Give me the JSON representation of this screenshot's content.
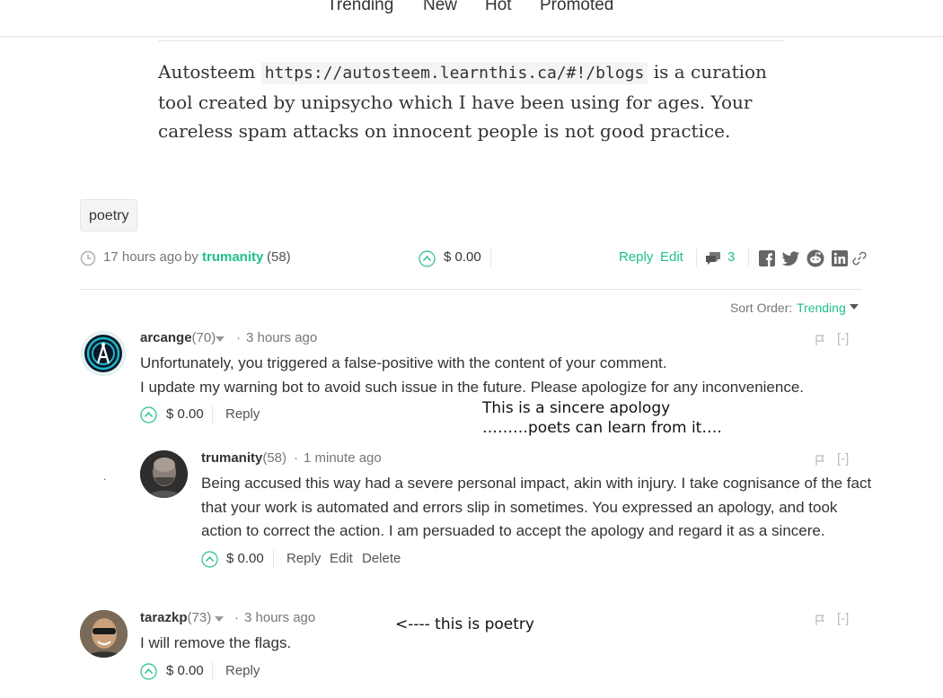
{
  "nav": {
    "items": [
      "Trending",
      "New",
      "Hot",
      "Promoted"
    ]
  },
  "post": {
    "text_before": "Autosteem ",
    "code": "https://autosteem.learnthis.ca/#!/blogs",
    "text_after": " is a curation tool created by unipsycho which I have been using for ages. Your careless spam attacks on innocent people is not good practice.",
    "tag": "poetry",
    "time": "17 hours ago",
    "by": "by",
    "author": "trumanity",
    "author_rep": "(58)",
    "payout": "$ 0.00",
    "reply": "Reply",
    "edit": "Edit",
    "comment_count": "3"
  },
  "sort": {
    "label": "Sort Order:",
    "value": "Trending"
  },
  "comments": [
    {
      "author": "arcange",
      "rep": "(70)",
      "time": "3 hours ago",
      "lines": [
        "Unfortunately, you triggered a false-positive with the content of your comment.",
        "I update my warning bot to avoid such issue in the future. Please apologize for any inconvenience."
      ],
      "payout": "$ 0.00",
      "reply": "Reply",
      "collapse": "[-]"
    },
    {
      "author": "trumanity",
      "rep": "(58)",
      "time": "1 minute ago",
      "lines": [
        "Being accused this way had a severe personal impact, akin with injury. I take cognisance of the fact",
        "that your work is automated and errors slip in sometimes. You expressed an apology, and took",
        "action to correct the action. I am persuaded to accept the apology and regard it as a sincere."
      ],
      "payout": "$ 0.00",
      "reply": "Reply",
      "edit": "Edit",
      "delete": "Delete",
      "collapse": "[-]"
    },
    {
      "author": "tarazkp",
      "rep": "(73)",
      "time": "3 hours ago",
      "lines": [
        "I will remove the flags."
      ],
      "payout": "$ 0.00",
      "reply": "Reply",
      "collapse": "[-]"
    }
  ],
  "annotations": {
    "note1_line1": "This is a sincere apology",
    "note1_line2": "………poets can learn from it….",
    "note2": "<---- this is poetry"
  },
  "colors": {
    "accent": "#1fbf8f",
    "text": "#333333",
    "muted": "#777777"
  }
}
